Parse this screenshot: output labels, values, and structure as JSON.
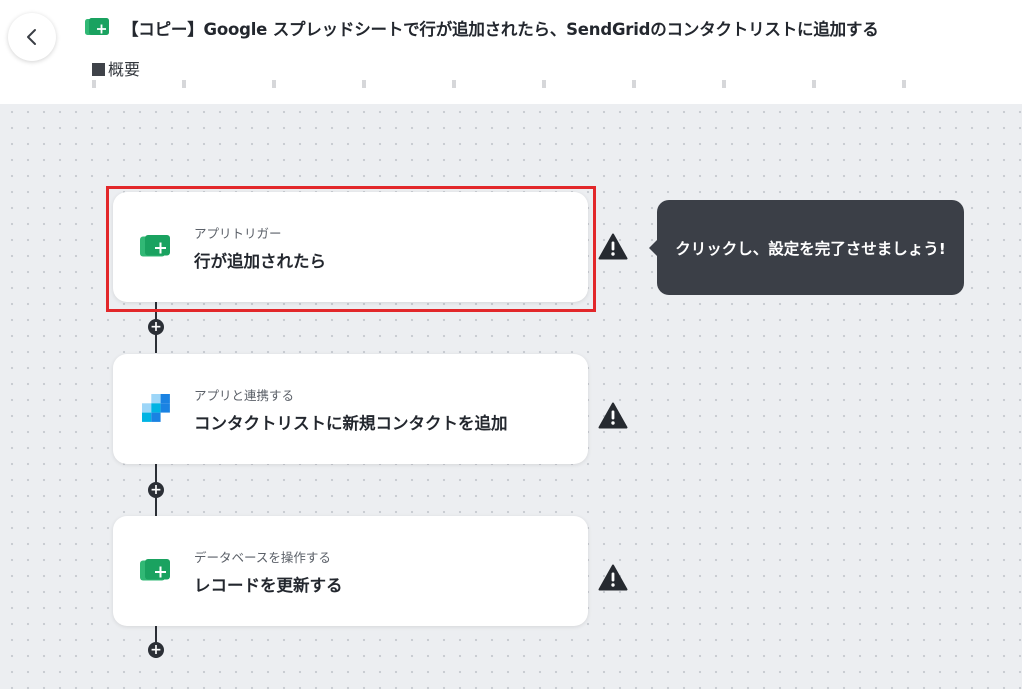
{
  "header": {
    "title": "【コピー】Google スプレッドシートで行が追加されたら、SendGridのコンタクトリストに追加する",
    "overview_label": "概要"
  },
  "steps": [
    {
      "type": "アプリトリガー",
      "name": "行が追加されたら",
      "icon": "google-sheets-icon",
      "status": "warning"
    },
    {
      "type": "アプリと連携する",
      "name": "コンタクトリストに新規コンタクトを追加",
      "icon": "sendgrid-icon",
      "status": "warning"
    },
    {
      "type": "データベースを操作する",
      "name": "レコードを更新する",
      "icon": "google-sheets-icon",
      "status": "warning"
    }
  ],
  "tooltip": {
    "text": "クリックし、設定を完了させましょう!"
  },
  "colors": {
    "sheets_green": "#1aa260",
    "sendgrid_blue": "#1a82e2",
    "highlight_red": "#e2272a",
    "tooltip_bg": "#3b3f47",
    "canvas_bg": "#eceef1"
  }
}
